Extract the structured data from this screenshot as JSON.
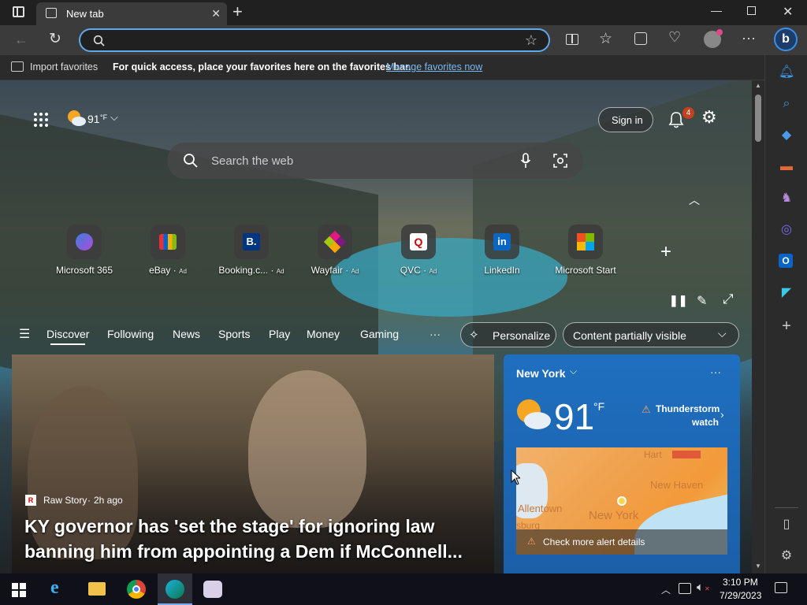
{
  "browser": {
    "tab_title": "New tab",
    "address_value": "",
    "favorites_bar": {
      "import_label": "Import favorites",
      "hint_text": "For quick access, place your favorites here on the favorites bar.",
      "manage_link": "Manage favorites now"
    }
  },
  "newtab": {
    "weather_small": {
      "temp": "91",
      "unit": "°F"
    },
    "sign_in_label": "Sign in",
    "notifications_count": "4",
    "search_placeholder": "Search the web",
    "quick_links": [
      {
        "label": "Microsoft 365",
        "ad": ""
      },
      {
        "label": "eBay",
        "ad": "Ad"
      },
      {
        "label": "Booking.c...",
        "ad": "Ad"
      },
      {
        "label": "Wayfair",
        "ad": "Ad"
      },
      {
        "label": "QVC",
        "ad": "Ad"
      },
      {
        "label": "LinkedIn",
        "ad": ""
      },
      {
        "label": "Microsoft Start",
        "ad": ""
      }
    ],
    "nav_tabs": [
      "Discover",
      "Following",
      "News",
      "Sports",
      "Play",
      "Money",
      "Gaming"
    ],
    "more_label": "···",
    "personalize_label": "Personalize",
    "content_visibility": "Content partially visible",
    "article": {
      "source": "Raw Story",
      "age": "2h ago",
      "headline": "KY governor has 'set the stage' for ignoring law banning him from appointing a Dem if McConnell..."
    },
    "weather_card": {
      "location": "New York",
      "temp": "91",
      "unit": "°F",
      "alert_line1": "Thunderstorm",
      "alert_line2": "watch",
      "map_labels": [
        "New Haven",
        "Allentown",
        "New York",
        "sburg",
        "Hart"
      ],
      "alert_details": "Check more alert details"
    }
  },
  "taskbar": {
    "time": "3:10 PM",
    "date": "7/29/2023"
  }
}
